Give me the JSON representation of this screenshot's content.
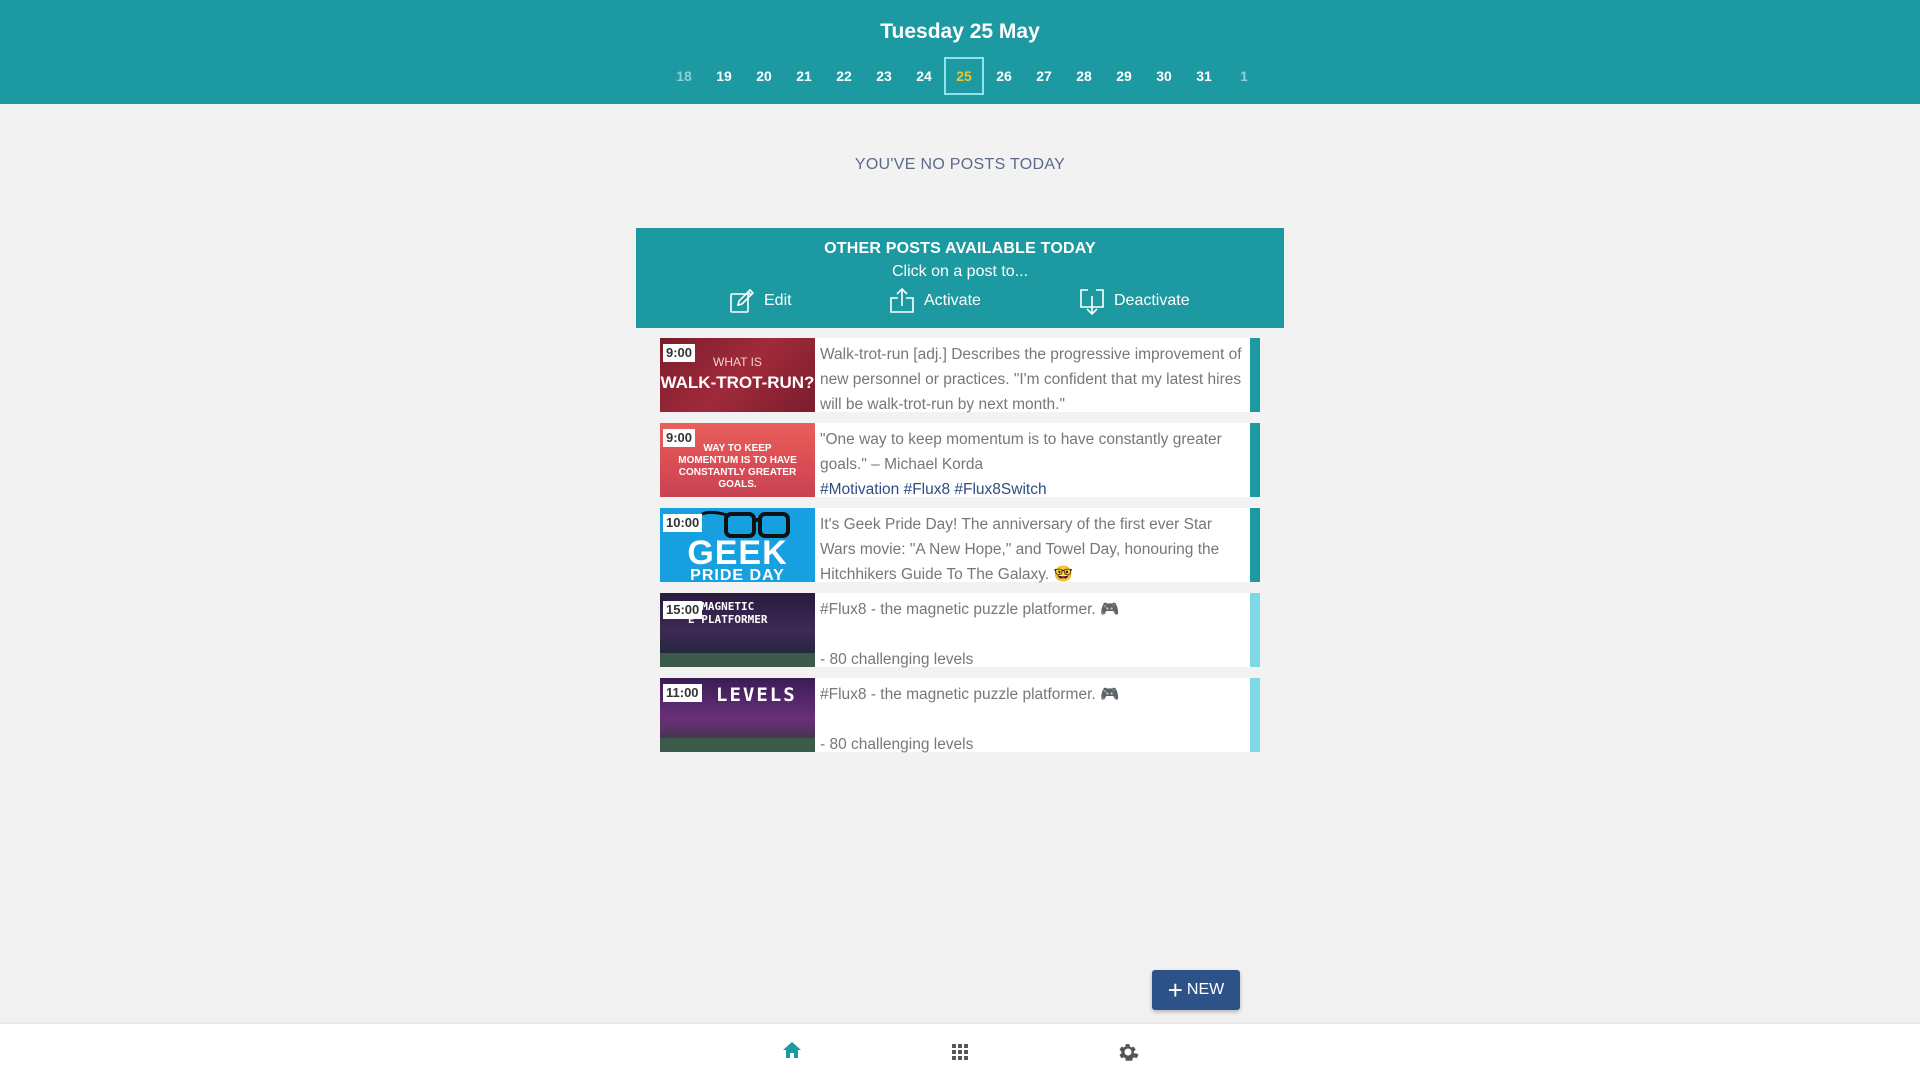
{
  "header": {
    "date_title": "Tuesday 25 May",
    "days": [
      {
        "label": "18",
        "state": "dim"
      },
      {
        "label": "19",
        "state": "normal"
      },
      {
        "label": "20",
        "state": "normal"
      },
      {
        "label": "21",
        "state": "normal"
      },
      {
        "label": "22",
        "state": "normal"
      },
      {
        "label": "23",
        "state": "normal"
      },
      {
        "label": "24",
        "state": "normal"
      },
      {
        "label": "25",
        "state": "selected"
      },
      {
        "label": "26",
        "state": "normal"
      },
      {
        "label": "27",
        "state": "normal"
      },
      {
        "label": "28",
        "state": "normal"
      },
      {
        "label": "29",
        "state": "normal"
      },
      {
        "label": "30",
        "state": "normal"
      },
      {
        "label": "31",
        "state": "normal"
      },
      {
        "label": "1",
        "state": "dim"
      }
    ]
  },
  "main": {
    "no_posts_text": "YOU'VE NO POSTS TODAY"
  },
  "other_posts": {
    "title": "OTHER POSTS AVAILABLE TODAY",
    "subtitle": "Click on a post to...",
    "actions": {
      "edit": "Edit",
      "activate": "Activate",
      "deactivate": "Deactivate"
    }
  },
  "posts": [
    {
      "time": "9:00",
      "thumb_text": [
        "WHAT IS",
        "WALK-TROT-RUN?"
      ],
      "text": "Walk-trot-run [adj.]   Describes the progressive improvement of new personnel or practices. \"I'm confident that my latest hires will be walk-trot-run by next month.\"",
      "tags": "",
      "status": "active"
    },
    {
      "time": "9:00",
      "thumb_text": [
        "WAY TO KEEP MOMENTUM IS TO HAVE CONSTANTLY GREATER GOALS."
      ],
      "text": "\"One way to keep momentum is to have constantly greater goals.\" – Michael Korda",
      "tags": "#Motivation #Flux8 #Flux8Switch",
      "status": "active"
    },
    {
      "time": "10:00",
      "thumb_text": [
        "GEEK",
        "PRIDE DAY"
      ],
      "text": "It's Geek Pride Day! The anniversary of the first ever Star Wars movie: \"A New Hope,\" and Towel Day, honouring the Hitchhikers Guide To The Galaxy. 🤓",
      "tags": "",
      "status": "active"
    },
    {
      "time": "15:00",
      "thumb_text": [
        "E MAGNETIC",
        "E PLATFORMER"
      ],
      "text": "#Flux8 - the magnetic puzzle platformer.  🎮",
      "text2": " - 80 challenging levels",
      "tags": "",
      "status": "inactive"
    },
    {
      "time": "11:00",
      "thumb_text": [
        "LEVELS"
      ],
      "text": "#Flux8 - the magnetic puzzle platformer.  🎮",
      "text2": " - 80 challenging levels",
      "tags": "",
      "status": "inactive"
    }
  ],
  "new_button": {
    "label": "NEW"
  },
  "bottom_nav": {
    "items": [
      "home-icon",
      "grid-icon",
      "gear-icon"
    ]
  },
  "colors": {
    "teal": "#1c99a1",
    "selected_day_text": "#f3c623",
    "active_bar": "#1c99a1",
    "inactive_bar": "#7fd8e6",
    "new_button": "#2c5287"
  }
}
